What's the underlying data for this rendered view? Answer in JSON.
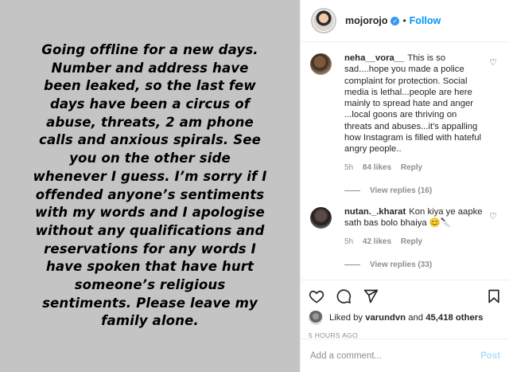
{
  "story": {
    "text": "Going offline for a new days. Number and address have been leaked, so the last few days have been a circus of abuse, threats, 2 am phone calls and anxious spirals. See you on the other side whenever I guess. I’m sorry if I offended anyone’s sentiments with my words and I apologise without any qualifications and reservations for any words I have spoken that have hurt someone’s religious sentiments. Please leave my family alone."
  },
  "header": {
    "username": "mojorojo",
    "verified_icon": "verified-badge-icon",
    "separator": "•",
    "follow_label": "Follow",
    "colors": {
      "link": "#0095f6",
      "verified": "#3897f0"
    }
  },
  "comments": [
    {
      "username": "neha__vora__",
      "text": "This is so sad....hope you made a police complaint for protection. Social media is lethal...people are here mainly to spread hate and anger ...local goons are thriving on threats and abuses...it's appalling how Instagram is filled with hateful angry people..",
      "time": "5h",
      "likes": "84 likes",
      "reply_label": "Reply",
      "view_replies": "View replies (16)"
    },
    {
      "username": "nutan._.kharat",
      "text": "Kon kiya ye aapke sath bas bolo bhaiya 😊🔪",
      "time": "5h",
      "likes": "42 likes",
      "reply_label": "Reply",
      "view_replies": "View replies (33)"
    }
  ],
  "actions": {
    "like_icon": "heart-icon",
    "comment_icon": "comment-icon",
    "share_icon": "share-icon",
    "save_icon": "bookmark-icon"
  },
  "likes_summary": {
    "prefix": "Liked by",
    "user": "varundvn",
    "middle": "and",
    "count": "45,418 others"
  },
  "timestamp": "5 HOURS AGO",
  "add_comment": {
    "placeholder": "Add a comment...",
    "post_label": "Post"
  }
}
